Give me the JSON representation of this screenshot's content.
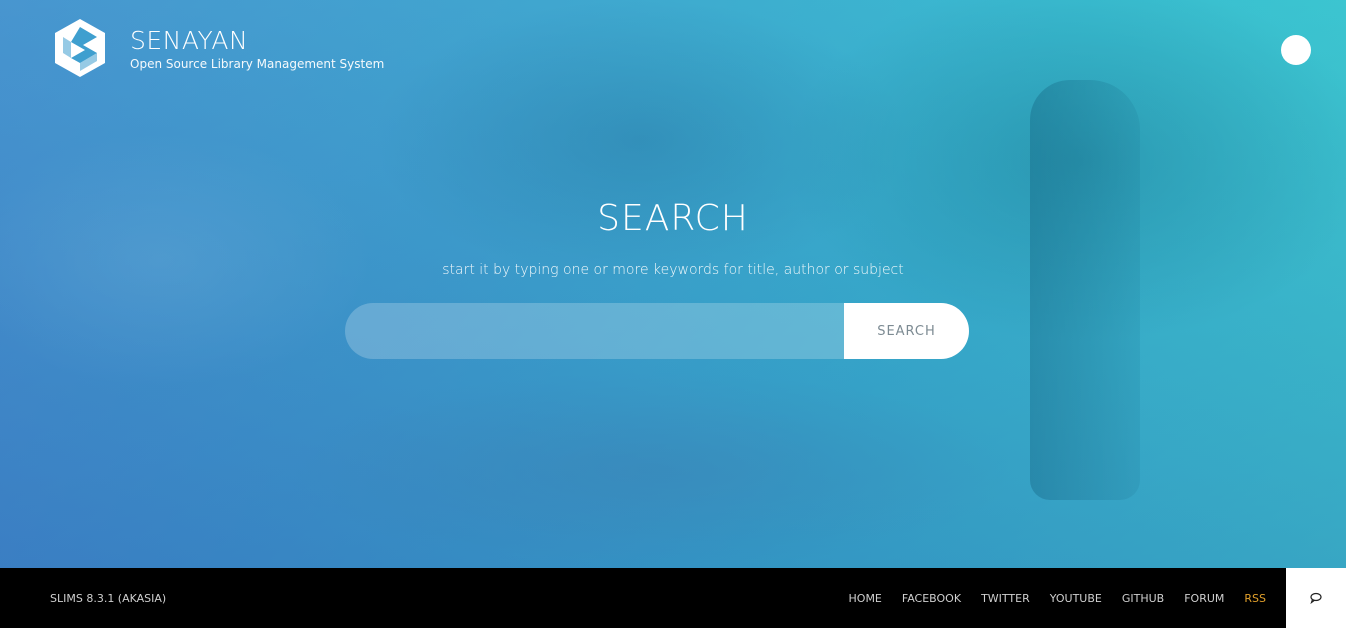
{
  "header": {
    "brand_title": "SENAYAN",
    "brand_subtitle": "Open Source Library Management System",
    "logo_icon": "senayan-logo-icon",
    "menu_icon": "menu-circle-icon"
  },
  "search": {
    "title": "SEARCH",
    "subtitle": "start it by typing one or more keywords for title, author or subject",
    "input_value": "",
    "placeholder": "",
    "button_label": "SEARCH"
  },
  "footer": {
    "version": "SLIMS 8.3.1 (AKASIA)",
    "nav": [
      "HOME",
      "FACEBOOK",
      "TWITTER",
      "YOUTUBE",
      "GITHUB",
      "FORUM",
      "RSS"
    ],
    "rss_color": "#e3a12b",
    "chat_icon": "chat-bubble-icon"
  },
  "colors": {
    "hero_gradient_start": "#4a8fd0",
    "hero_gradient_end": "#3cc9cf",
    "footer_bg": "#000000"
  }
}
